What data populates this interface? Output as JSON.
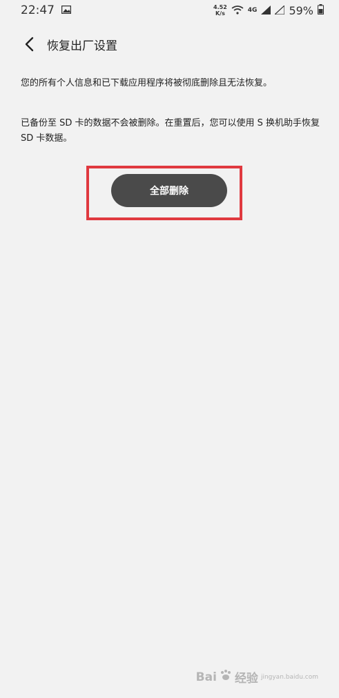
{
  "status_bar": {
    "time": "22:47",
    "net_speed_value": "4.52",
    "net_speed_unit": "K/s",
    "network_type": "4G",
    "battery_percent": "59%"
  },
  "header": {
    "title": "恢复出厂设置"
  },
  "content": {
    "warning_text": "您的所有个人信息和已下载应用程序将被彻底删除且无法恢复。",
    "sd_note": "已备份至 SD 卡的数据不会被删除。在重置后，您可以使用 S 换机助手恢复 SD 卡数据。",
    "reset_button_label": "全部删除"
  },
  "watermark": {
    "brand": "Bai",
    "brand_suffix": "经验",
    "domain": "jingyan.baidu.com"
  },
  "colors": {
    "background": "#f2f2f2",
    "button": "#4a4a4a",
    "highlight_border": "#e0393f"
  }
}
